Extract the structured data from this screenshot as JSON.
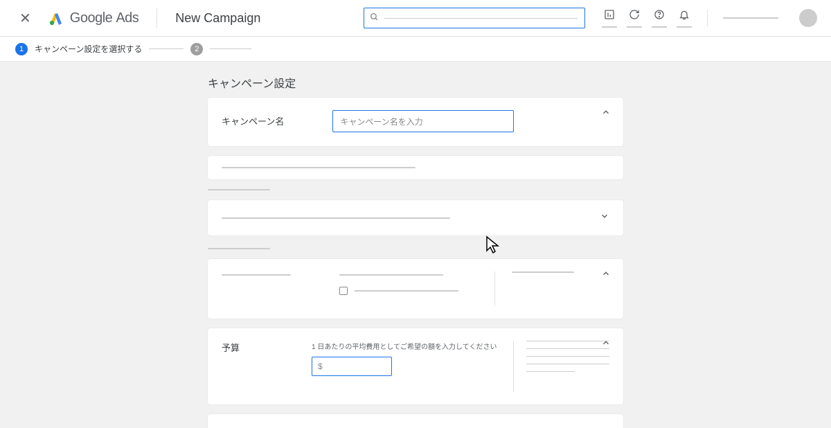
{
  "header": {
    "brand_google": "Google",
    "brand_ads": "Ads",
    "page_title": "New Campaign"
  },
  "stepper": {
    "step1_num": "1",
    "step1_label": "キャンペーン設定を選択する",
    "step2_num": "2"
  },
  "main": {
    "section_heading": "キャンペーン設定",
    "name_card": {
      "label": "キャンペーン名",
      "placeholder": "キャンペーン名を入力"
    },
    "budget_card": {
      "label": "予算",
      "help_text": "1 日あたりの平均費用としてご希望の額を入力してください",
      "currency": "$"
    }
  }
}
